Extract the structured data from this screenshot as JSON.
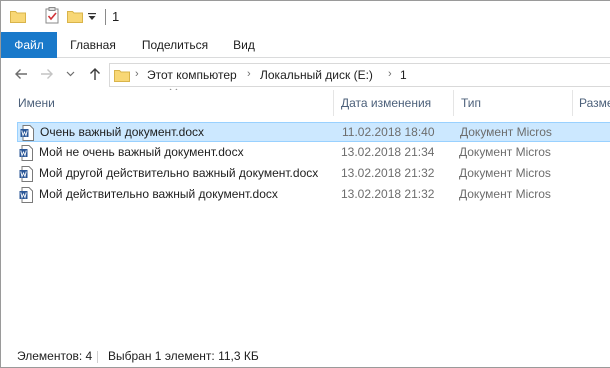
{
  "window": {
    "title": "1"
  },
  "ribbon": {
    "tabs": [
      {
        "label": "Файл"
      },
      {
        "label": "Главная"
      },
      {
        "label": "Поделиться"
      },
      {
        "label": "Вид"
      }
    ]
  },
  "address_bar": {
    "crumbs": [
      "Этот компьютер",
      "Локальный диск (E:)",
      "1"
    ]
  },
  "columns": {
    "name": "Имени",
    "date": "Дата изменения",
    "type": "Тип",
    "size": "Разме"
  },
  "files": [
    {
      "name": "Очень важный документ.docx",
      "date": "11.02.2018 18:40",
      "type": "Документ Micros",
      "selected": true
    },
    {
      "name": "Мой не очень важный документ.docx",
      "date": "13.02.2018 21:34",
      "type": "Документ Micros",
      "selected": false
    },
    {
      "name": "Мой другой действительно важный документ.docx",
      "date": "13.02.2018 21:32",
      "type": "Документ Micros",
      "selected": false
    },
    {
      "name": "Мой действительно важный документ.docx",
      "date": "13.02.2018 21:32",
      "type": "Документ Micros",
      "selected": false
    }
  ],
  "status": {
    "items_count": "Элементов: 4",
    "selection": "Выбран 1 элемент: 11,3 КБ"
  },
  "colors": {
    "accent": "#1979ca",
    "selection_bg": "#cce8ff",
    "selection_border": "#99d1ff",
    "header_text": "#4c607a",
    "meta_text": "#6d6d6d",
    "folder_yellow": "#f8d775",
    "word_blue": "#2b5797"
  }
}
